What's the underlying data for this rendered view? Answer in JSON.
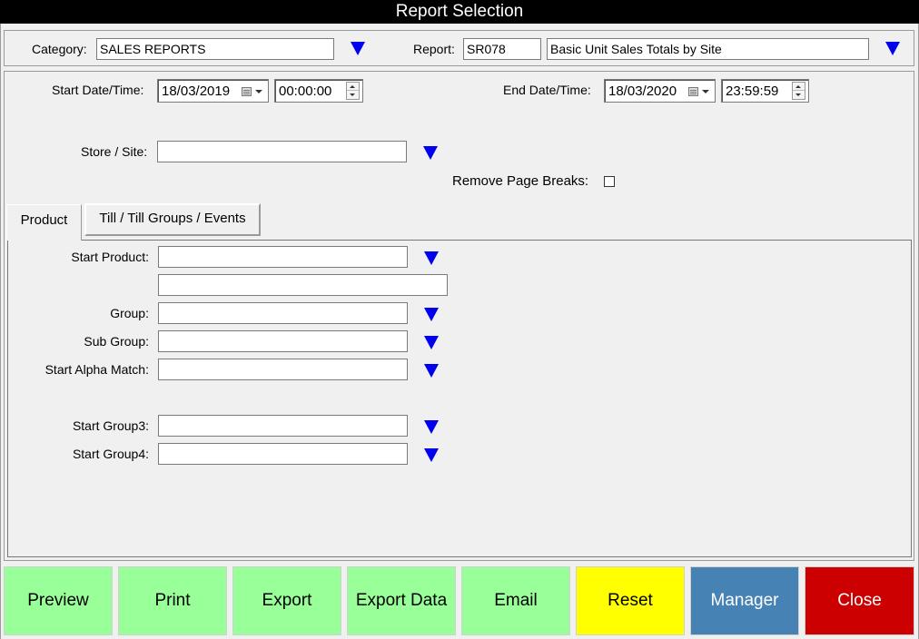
{
  "window": {
    "title": "Report Selection"
  },
  "header": {
    "category_label": "Category:",
    "category_value": "SALES REPORTS",
    "report_label": "Report:",
    "report_code": "SR078",
    "report_name": "Basic Unit Sales Totals by Site"
  },
  "filters": {
    "start_label": "Start Date/Time:",
    "start_date": "18/03/2019",
    "start_time": "00:00:00",
    "end_label": "End Date/Time:",
    "end_date": "18/03/2020",
    "end_time": "23:59:59",
    "store_label": "Store / Site:",
    "store_value": "",
    "page_breaks_label": "Remove Page Breaks:",
    "page_breaks_checked": false
  },
  "tabs": [
    {
      "label": "Product",
      "active": true
    },
    {
      "label": "Till / Till Groups / Events",
      "active": false
    }
  ],
  "product": {
    "start_product_label": "Start Product:",
    "group_label": "Group:",
    "sub_group_label": "Sub Group:",
    "alpha_label": "Start Alpha Match:",
    "group3_label": "Start Group3:",
    "group4_label": "Start Group4:"
  },
  "buttons": {
    "preview": "Preview",
    "print": "Print",
    "export": "Export",
    "export_data": "Export Data",
    "email": "Email",
    "reset": "Reset",
    "manager": "Manager",
    "close": "Close"
  },
  "colors": {
    "action_green": "#99ff99",
    "reset_yellow": "#ffff00",
    "manager_blue": "#4682b4",
    "close_red": "#cc0000",
    "dropdown_arrow": "#0000ee"
  }
}
